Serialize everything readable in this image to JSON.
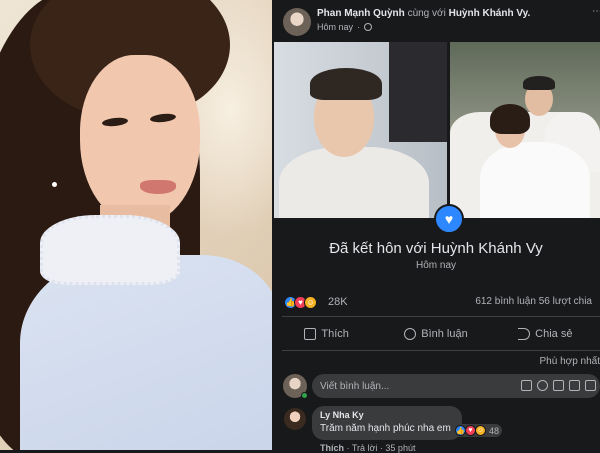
{
  "post": {
    "author": "Phan Mạnh Quỳnh",
    "with_text": "cùng với",
    "tagged": "Huỳnh Khánh Vy.",
    "time": "Hôm nay",
    "life_event": {
      "title": "Đã kết hôn với Huỳnh Khánh Vy",
      "date": "Hôm nay"
    },
    "reactions": {
      "count": "28K",
      "comments": "612 bình luận",
      "shares": "56 lượt chia"
    },
    "actions": {
      "like": "Thích",
      "comment": "Bình luận",
      "share": "Chia sẻ"
    },
    "sort": "Phù hợp nhất",
    "composer_placeholder": "Viết bình luận...",
    "comment": {
      "author": "Ly Nha Ky",
      "text": "Trăm năm hạnh phúc nha em",
      "reaction_count": "48",
      "like": "Thích",
      "reply": "Trả lời",
      "time": "35 phút"
    }
  },
  "colors": {
    "background": "#18191a",
    "bubble": "#3a3b3c",
    "accent": "#2d88ff",
    "love": "#f33e58",
    "care": "#f7b125",
    "online": "#31a24c"
  }
}
